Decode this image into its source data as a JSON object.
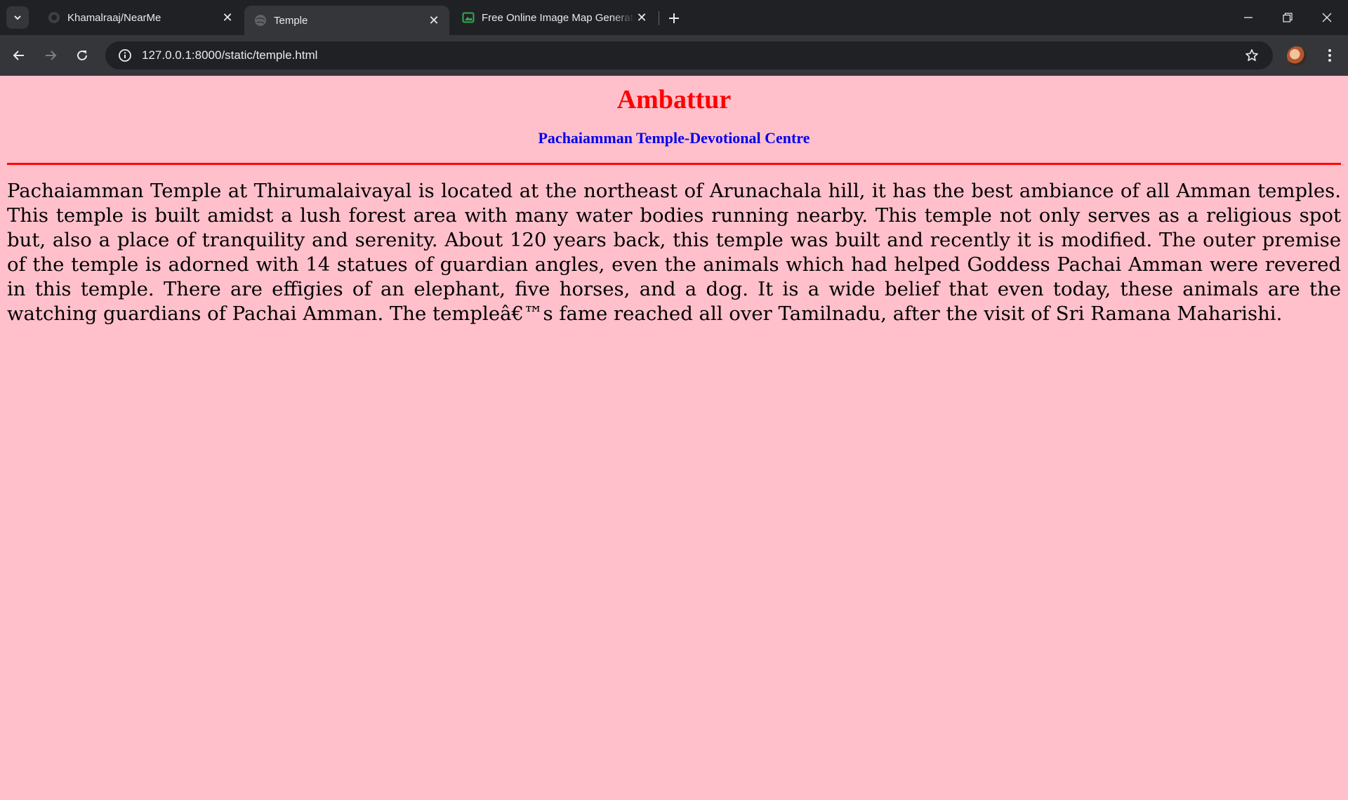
{
  "browser": {
    "tabs": [
      {
        "title": "Khamalraaj/NearMe",
        "favicon": "github-icon",
        "active": false
      },
      {
        "title": "Temple",
        "favicon": "globe-icon",
        "active": true
      },
      {
        "title": "Free Online Image Map Generator",
        "favicon": "image-icon",
        "active": false
      }
    ],
    "address_bar": {
      "url": "127.0.0.1:8000/static/temple.html"
    }
  },
  "page": {
    "heading": "Ambattur",
    "subheading": "Pachaiamman Temple-Devotional Centre",
    "paragraph": "Pachaiamman Temple at Thirumalaivayal is located at the northeast of Arunachala hill, it has the best ambiance of all Amman temples. This temple is built amidst a lush forest area with many water bodies running nearby. This temple not only serves as a religious spot but, also a place of tranquility and serenity. About 120 years back, this temple was built and recently it is modified. The outer premise of the temple is adorned with 14 statues of guardian angles, even the animals which had helped Goddess Pachai Amman were revered in this temple. There are effigies of an elephant, five horses, and a dog. It is a wide belief that even today, these animals are the watching guardians of Pachai Amman. The templeâ€™s fame reached all over Tamilnadu, after the visit of Sri Ramana Maharishi.",
    "colors": {
      "background": "#ffc0cb",
      "heading": "#ff0000",
      "subheading": "#0000ee",
      "rule": "#ff0000"
    }
  }
}
